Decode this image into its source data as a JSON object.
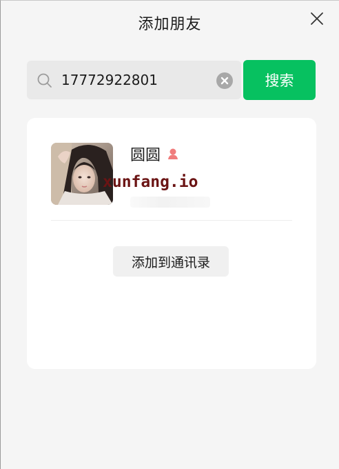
{
  "window": {
    "title": "添加朋友"
  },
  "search": {
    "value": "17772922801",
    "button_label": "搜索"
  },
  "result": {
    "name": "圆圆",
    "gender": "female",
    "watermark": "xunfang.io"
  },
  "actions": {
    "add_label": "添加到通讯录"
  },
  "colors": {
    "accent": "#07c160",
    "female_icon": "#f07c7c",
    "watermark": "#6b1414"
  },
  "icons": {
    "close": "close-icon",
    "search": "search-icon",
    "clear": "clear-icon",
    "gender": "female-person-icon"
  }
}
